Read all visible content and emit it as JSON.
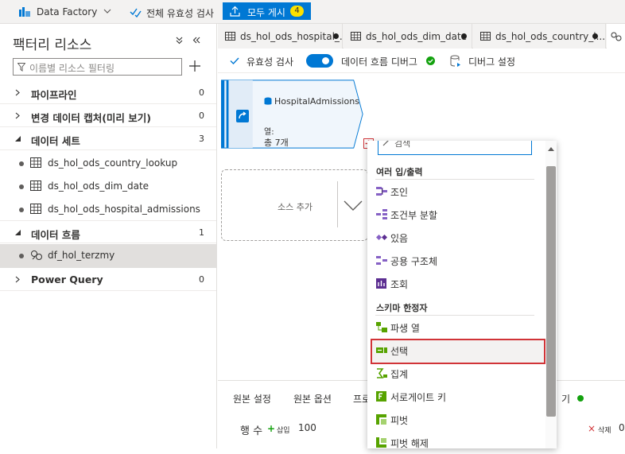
{
  "topbar": {
    "app_name": "Data Factory",
    "validate_all": "전체 유효성 검사",
    "publish_all": "모두 게시",
    "publish_count": "4"
  },
  "left_panel": {
    "title": "팩터리 리소스",
    "filter_placeholder": "이름별 리소스 필터링",
    "sections": [
      {
        "label": "파이프라인",
        "count": "0"
      },
      {
        "label": "변경 데이터 캡처(미리 보기)",
        "count": "0"
      },
      {
        "label": "데이터 세트",
        "count": "3"
      },
      {
        "label": "데이터 흐름",
        "count": "1"
      },
      {
        "label": "Power Query",
        "count": "0"
      }
    ],
    "datasets": [
      "ds_hol_ods_country_lookup",
      "ds_hol_ods_dim_date",
      "ds_hol_ods_hospital_admissions"
    ],
    "dataflows": [
      "df_hol_terzmy"
    ]
  },
  "tabs": [
    {
      "label": "ds_hol_ods_hospital_..."
    },
    {
      "label": "ds_hol_ods_dim_date"
    },
    {
      "label": "ds_hol_ods_country_l..."
    }
  ],
  "toolbar": {
    "validate": "유효성 검사",
    "debug": "데이터 흐름 디버그",
    "debug_settings": "디버그 설정"
  },
  "canvas": {
    "node_title": "HospitalAdmissions",
    "node_columns_label": "열:",
    "node_total": "총 7개",
    "add_source": "소스 추가"
  },
  "bottom": {
    "tab_source_settings": "원본 설정",
    "tab_source_options": "원본 옵션",
    "tab_partial": "프로",
    "tab_preview_partial": "기",
    "rows_label": "행 수",
    "insert_label": "삽입",
    "insert_value": "100",
    "delete_label": "삭제",
    "delete_value": "0"
  },
  "dropdown": {
    "search_placeholder": "검색",
    "group_multi": "여러 입/출력",
    "multi_items": [
      "조인",
      "조건부 분할",
      "있음",
      "공용 구조체",
      "조회"
    ],
    "group_schema": "스키마 한정자",
    "schema_items": [
      "파생 열",
      "선택",
      "집계",
      "서로게이트 키",
      "피벗",
      "피벗 해제"
    ]
  },
  "colors": {
    "accent": "#0078d4",
    "badge": "#fce100",
    "highlight": "#d13438",
    "ok": "#13a10e"
  }
}
